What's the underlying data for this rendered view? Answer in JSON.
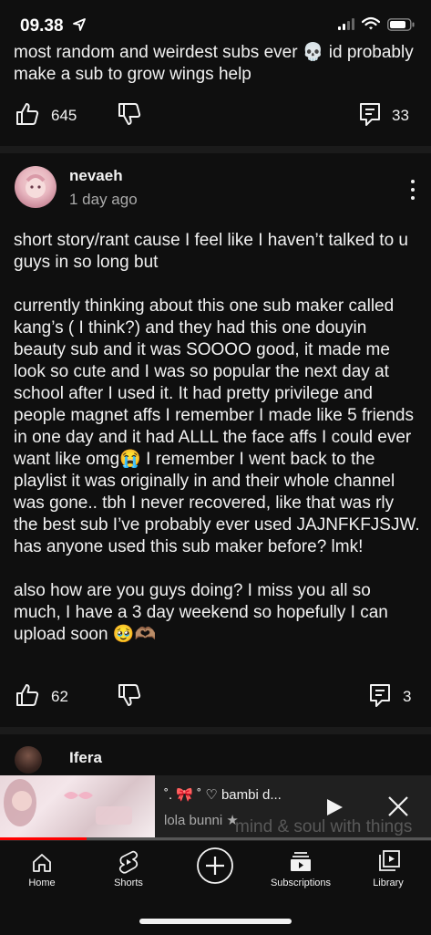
{
  "status_bar": {
    "time": "09.38"
  },
  "previous_post": {
    "text": "most random and weirdest subs ever 💀 id probably make a sub to grow wings help",
    "likes": "645",
    "replies": "33"
  },
  "comment": {
    "author": "nevaeh",
    "time_ago": "1 day ago",
    "paragraphs": [
      "short story/rant cause I feel like I haven’t talked to u guys in so long but",
      "currently thinking about this one sub maker called kang’s ( I think?) and they had this one douyin beauty sub and it was SOOOO good, it made me look so cute and I was so popular the next day at school after I used it. It had pretty privilege and people magnet affs I remember I made like 5 friends in one day and it had ALLL the face affs I could ever want like omg😭 I remember I went back to the playlist it was originally in and their whole channel was gone.. tbh I never recovered, like that was rly the best sub I’ve probably ever used JAJNFKFJSJW. has anyone used this sub maker before? lmk!",
      "also how are you guys doing? I miss you all so much, I have a 3 day weekend so hopefully I can upload soon 🥹🫶🏽"
    ],
    "likes": "62",
    "replies": "3"
  },
  "next_comment": {
    "author": "Ifera",
    "partial_text": "mind & soul with things"
  },
  "miniplayer": {
    "title": "˚. 🎀 ˚ ♡ bambi d...",
    "channel": "lola bunni ★",
    "progress": 0.2
  },
  "bottom_nav": {
    "home": "Home",
    "shorts": "Shorts",
    "subscriptions": "Subscriptions",
    "library": "Library"
  }
}
